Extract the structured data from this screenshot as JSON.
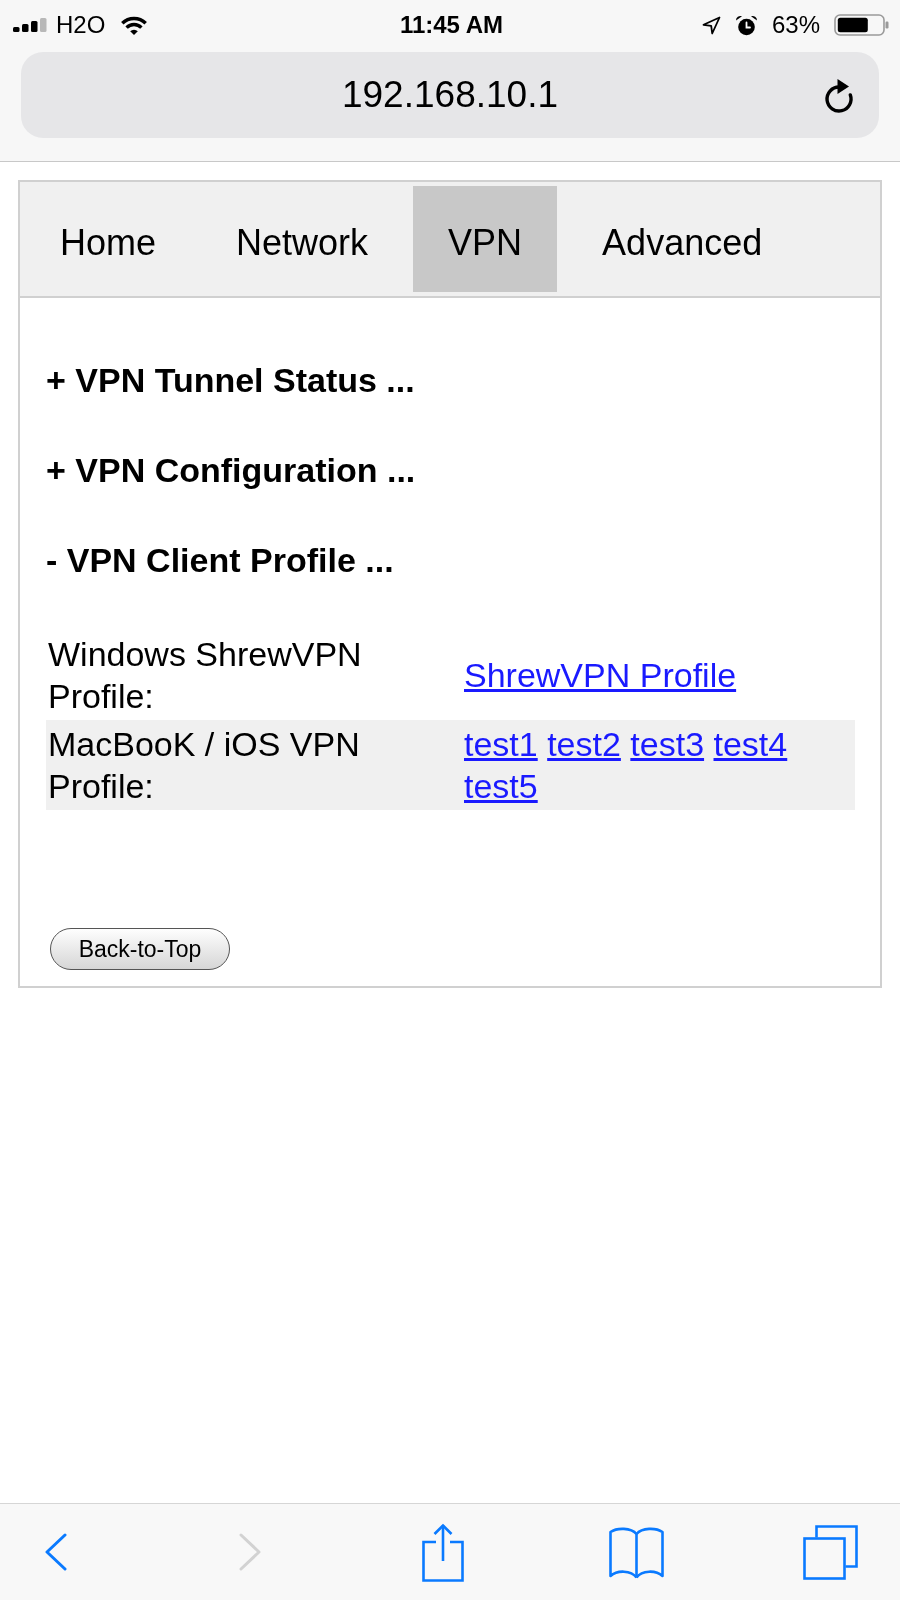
{
  "status_bar": {
    "carrier": "H2O",
    "time": "11:45 AM",
    "battery": "63%"
  },
  "address_bar": {
    "url": "192.168.10.1"
  },
  "tabs": [
    {
      "label": "Home",
      "selected": false
    },
    {
      "label": "Network",
      "selected": false
    },
    {
      "label": "VPN",
      "selected": true
    },
    {
      "label": "Advanced",
      "selected": false
    }
  ],
  "sections": [
    {
      "title": "+ VPN Tunnel Status ..."
    },
    {
      "title": "+ VPN Configuration ..."
    },
    {
      "title": "- VPN Client Profile ...",
      "rows": [
        {
          "label": "Windows ShrewVPN Profile:",
          "links": [
            "ShrewVPN Profile"
          ]
        },
        {
          "label": "MacBooK / iOS VPN Profile:",
          "links": [
            "test1",
            "test2",
            "test3",
            "test4",
            "test5"
          ]
        }
      ]
    }
  ],
  "back_to_top": {
    "label": "Back-to-Top"
  },
  "toolbar": [
    {
      "kind": "back",
      "disabled": false
    },
    {
      "kind": "forward",
      "disabled": true
    },
    {
      "kind": "share",
      "disabled": false
    },
    {
      "kind": "bookmarks",
      "disabled": false
    },
    {
      "kind": "tabs",
      "disabled": false
    }
  ]
}
